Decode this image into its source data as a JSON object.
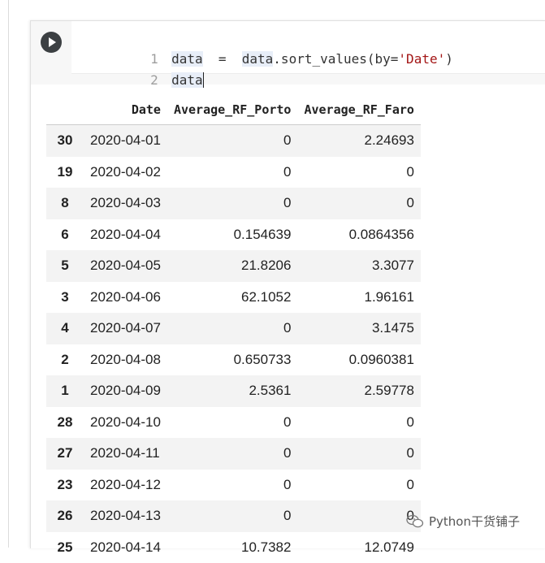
{
  "notebook": {
    "code_lines": [
      {
        "num": "1",
        "tokens": [
          "data",
          "=",
          "data",
          ".sort_values(by=",
          "'Date'",
          ")"
        ]
      },
      {
        "num": "2",
        "tokens": [
          "data"
        ]
      }
    ]
  },
  "output": {
    "columns": [
      "",
      "Date",
      "Average_RF_Porto",
      "Average_RF_Faro"
    ],
    "rows": [
      {
        "index": "30",
        "date": "2020-04-01",
        "porto": "0",
        "faro": "2.24693"
      },
      {
        "index": "19",
        "date": "2020-04-02",
        "porto": "0",
        "faro": "0"
      },
      {
        "index": "8",
        "date": "2020-04-03",
        "porto": "0",
        "faro": "0"
      },
      {
        "index": "6",
        "date": "2020-04-04",
        "porto": "0.154639",
        "faro": "0.0864356"
      },
      {
        "index": "5",
        "date": "2020-04-05",
        "porto": "21.8206",
        "faro": "3.3077"
      },
      {
        "index": "3",
        "date": "2020-04-06",
        "porto": "62.1052",
        "faro": "1.96161"
      },
      {
        "index": "4",
        "date": "2020-04-07",
        "porto": "0",
        "faro": "3.1475"
      },
      {
        "index": "2",
        "date": "2020-04-08",
        "porto": "0.650733",
        "faro": "0.0960381"
      },
      {
        "index": "1",
        "date": "2020-04-09",
        "porto": "2.5361",
        "faro": "2.59778"
      },
      {
        "index": "28",
        "date": "2020-04-10",
        "porto": "0",
        "faro": "0"
      },
      {
        "index": "27",
        "date": "2020-04-11",
        "porto": "0",
        "faro": "0"
      },
      {
        "index": "23",
        "date": "2020-04-12",
        "porto": "0",
        "faro": "0"
      },
      {
        "index": "26",
        "date": "2020-04-13",
        "porto": "0",
        "faro": "0"
      },
      {
        "index": "25",
        "date": "2020-04-14",
        "porto": "10.7382",
        "faro": "12.0749"
      }
    ]
  },
  "watermark": {
    "text": "Python干货铺子",
    "icon": "wechat-icon"
  },
  "colors": {
    "code_string": "#a31515",
    "run_button": "#3c4043"
  }
}
